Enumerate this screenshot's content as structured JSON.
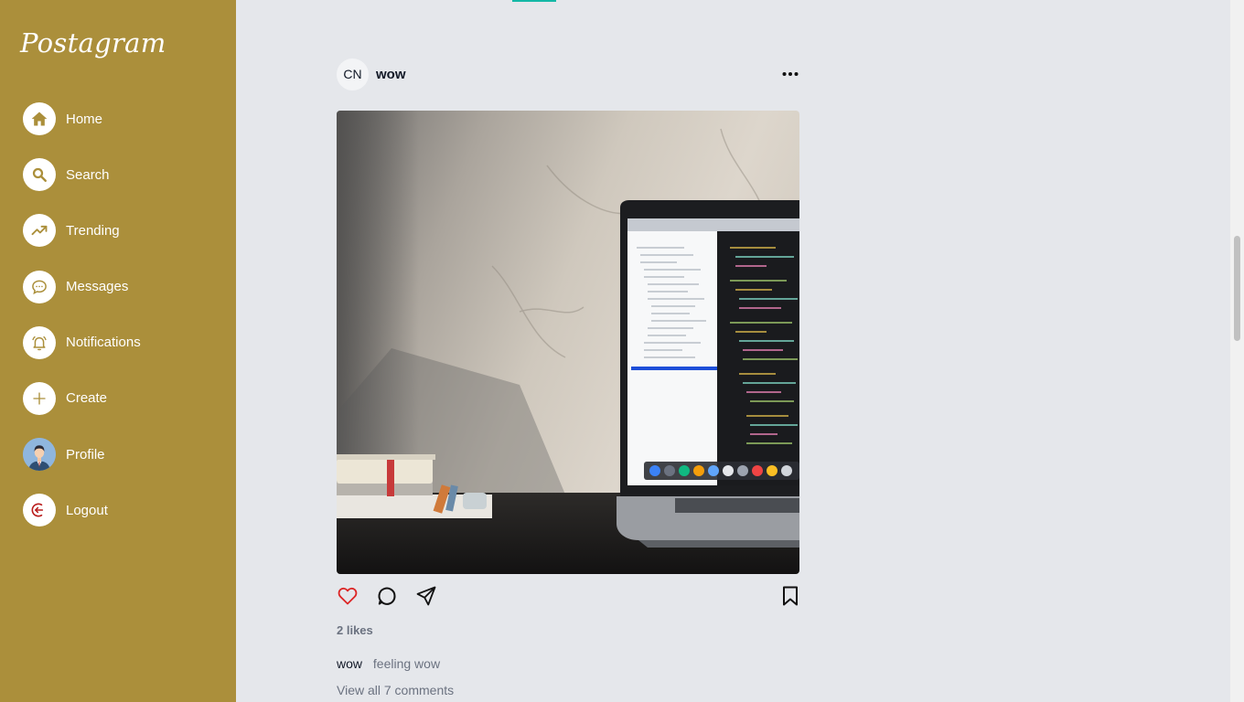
{
  "app": {
    "logo_text": "Postagram"
  },
  "sidebar": {
    "items": [
      {
        "label": "Home",
        "icon": "home-icon"
      },
      {
        "label": "Search",
        "icon": "search-icon"
      },
      {
        "label": "Trending",
        "icon": "trending-icon"
      },
      {
        "label": "Messages",
        "icon": "messages-icon"
      },
      {
        "label": "Notifications",
        "icon": "bell-icon"
      },
      {
        "label": "Create",
        "icon": "plus-icon"
      },
      {
        "label": "Profile",
        "icon": "profile-avatar"
      },
      {
        "label": "Logout",
        "icon": "logout-icon"
      }
    ]
  },
  "post": {
    "avatar_initials": "CN",
    "username": "wow",
    "likes_text": "2 likes",
    "caption_user": "wow",
    "caption_text": "feeling wow",
    "view_comments": "View all 7 comments",
    "image_description": "laptop-on-desk-photo"
  },
  "colors": {
    "sidebar_bg": "#ab8f3b",
    "page_bg": "#e5e7eb",
    "accent": "#14b8a6",
    "like": "#dc2626",
    "logout": "#b91c1c"
  }
}
